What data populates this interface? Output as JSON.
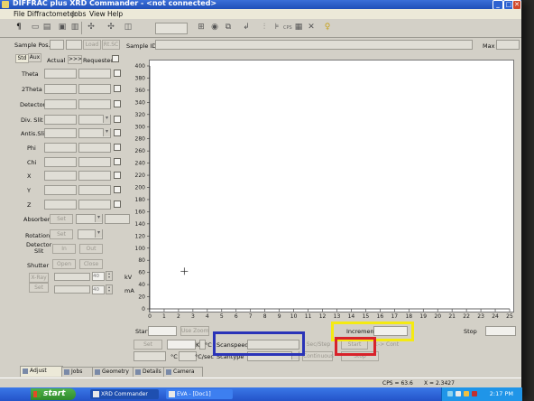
{
  "window": {
    "title": "DIFFRAC plus XRD Commander - <not connected>",
    "controls": [
      "_",
      "□",
      "✕"
    ]
  },
  "menu": [
    "File",
    "Diffractometer",
    "Jobs",
    "View",
    "Help"
  ],
  "toolbar": {
    "cps_label": "CPS"
  },
  "sample_row": {
    "sample_pos_label": "Sample Pos.",
    "load_label": "Load",
    "rt_sc_label": "Rt.SC",
    "sample_id_label": "Sample ID",
    "max_label": "Max"
  },
  "left_panel": {
    "tab_std": "Std",
    "tab_aux": "Aux",
    "actual_label": "Actual",
    "arrows_label": ">>>",
    "requested_label": "Requested",
    "axes": [
      "Theta",
      "2Theta",
      "Detector",
      "Div. Slit",
      "Antis.Slit",
      "Phi",
      "Chi",
      "X",
      "Y",
      "Z"
    ],
    "absorber_label": "Absorber",
    "absorber_set": "Set",
    "rotation_label": "Rotation",
    "rotation_set": "Set",
    "detector_slit_label": "Detector\nSlit",
    "in_label": "In",
    "out_label": "Out",
    "shutter_label": "Shutter",
    "open_label": "Open",
    "close_label": "Close",
    "kv_label": "kV",
    "ma_label": "mA",
    "kv_value": "40",
    "ma_value": "40",
    "xray_label": "X-Ray",
    "gen_set_label": "Set"
  },
  "scan": {
    "start_label": "Start",
    "use_zoom_label": "Use Zoom",
    "increment_label": "Increment",
    "stop_label": "Stop",
    "set_label": "Set",
    "k_label": "K",
    "deg_c_label": "°C",
    "scanspeed_label": "Scanspeed",
    "sec_step_label": "Sec/Step",
    "start_btn_label": "Start",
    "cont_label": "<-> Cont",
    "deg_c2_label": "°C",
    "deg_c_sec_label": "°C/sec",
    "scantype_label": "Scantype",
    "continuous_label": "Continuous",
    "stop_btn_label": "Stop"
  },
  "highlights": {
    "blue": "#2a33b8",
    "yellow": "#f4ea12",
    "red": "#d8222a"
  },
  "tabs": [
    "Adjust",
    "Jobs",
    "Geometry",
    "Details",
    "Camera"
  ],
  "status": {
    "cps": "CPS = 63.6",
    "x": "X = 2.3427"
  },
  "taskbar": {
    "start": "start",
    "tasks": [
      "XRD Commander",
      "EVA - [Doc1]"
    ],
    "clock": "2:17 PM"
  },
  "chart_data": {
    "type": "line",
    "x_ticks": [
      "0",
      "1",
      "2",
      "3",
      "4",
      "5",
      "6",
      "7",
      "8",
      "9",
      "10",
      "11",
      "12",
      "13",
      "14",
      "15",
      "16",
      "17",
      "18",
      "19",
      "20",
      "21",
      "22",
      "23",
      "24",
      "25"
    ],
    "y_ticks": [
      "0",
      "20",
      "40",
      "60",
      "80",
      "100",
      "120",
      "140",
      "160",
      "180",
      "200",
      "220",
      "240",
      "260",
      "280",
      "300",
      "320",
      "340",
      "360",
      "380",
      "400"
    ],
    "xlim": [
      0,
      25
    ],
    "ylim": [
      0,
      400
    ],
    "grid": false,
    "series": [],
    "cursor_marker": {
      "x": 2.4,
      "y": 62
    }
  }
}
